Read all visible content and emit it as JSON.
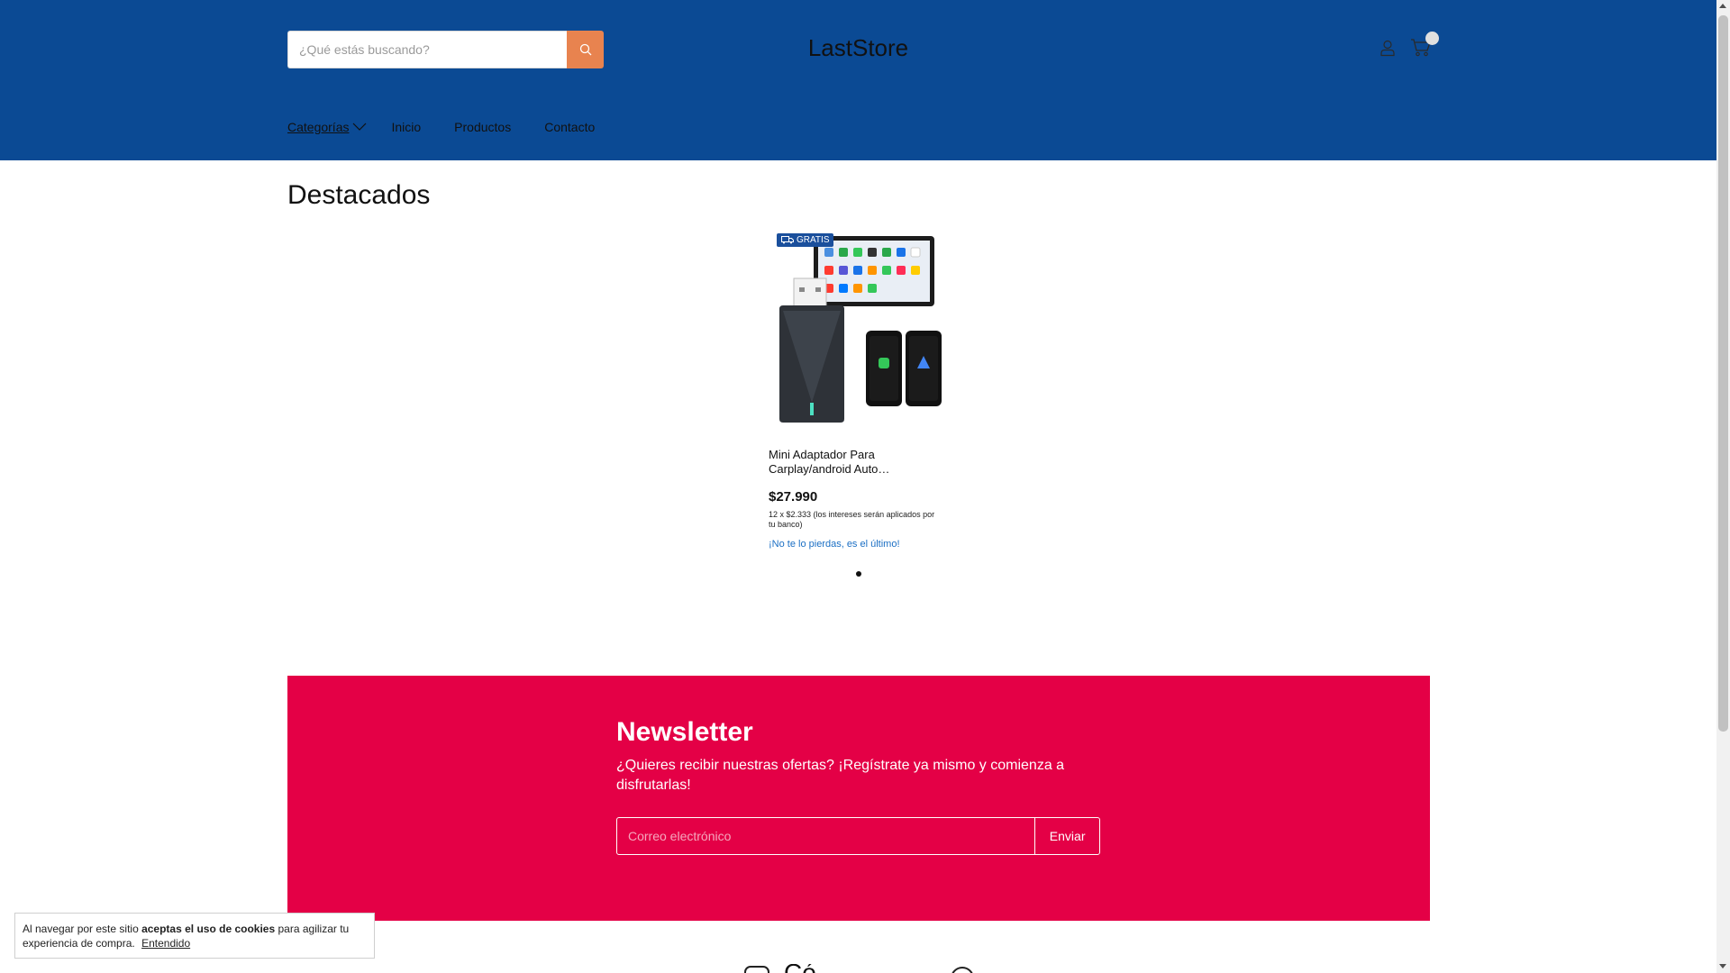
{
  "header": {
    "search_placeholder": "¿Qué estás buscando?",
    "store_name": "LastStore",
    "icons": [
      "search-icon",
      "user-icon",
      "cart-icon"
    ],
    "background_color": "#0b4a94"
  },
  "nav": {
    "items": [
      {
        "label": "Categorías"
      },
      {
        "label": "Inicio"
      },
      {
        "label": "Productos"
      },
      {
        "label": "Contacto"
      }
    ]
  },
  "featured": {
    "title": "Destacados",
    "products": [
      {
        "badge": "GRATIS",
        "name": "Mini Adaptador Para Carplay/android Auto…",
        "price": "$27.990",
        "installments": "12 x $2.333 (los intereses serán aplicados por tu banco)",
        "stock_note": "¡No te lo pierdas, es el último!"
      }
    ]
  },
  "newsletter": {
    "title": "Newsletter",
    "text": "¿Quieres recibir nuestras ofertas? ¡Regístrate ya mismo y comienza a disfrutarlas!",
    "email_placeholder": "Correo electrónico",
    "submit_label": "Enviar",
    "background_color": "#e40046"
  },
  "cookie_banner": {
    "text_before": "Al navegar por este sitio ",
    "text_bold": "aceptas el uso de cookies",
    "text_after": " para agilizar tu experiencia de compra.",
    "accept_label": "Entendido"
  },
  "footer": {
    "partial_text": "Có"
  }
}
